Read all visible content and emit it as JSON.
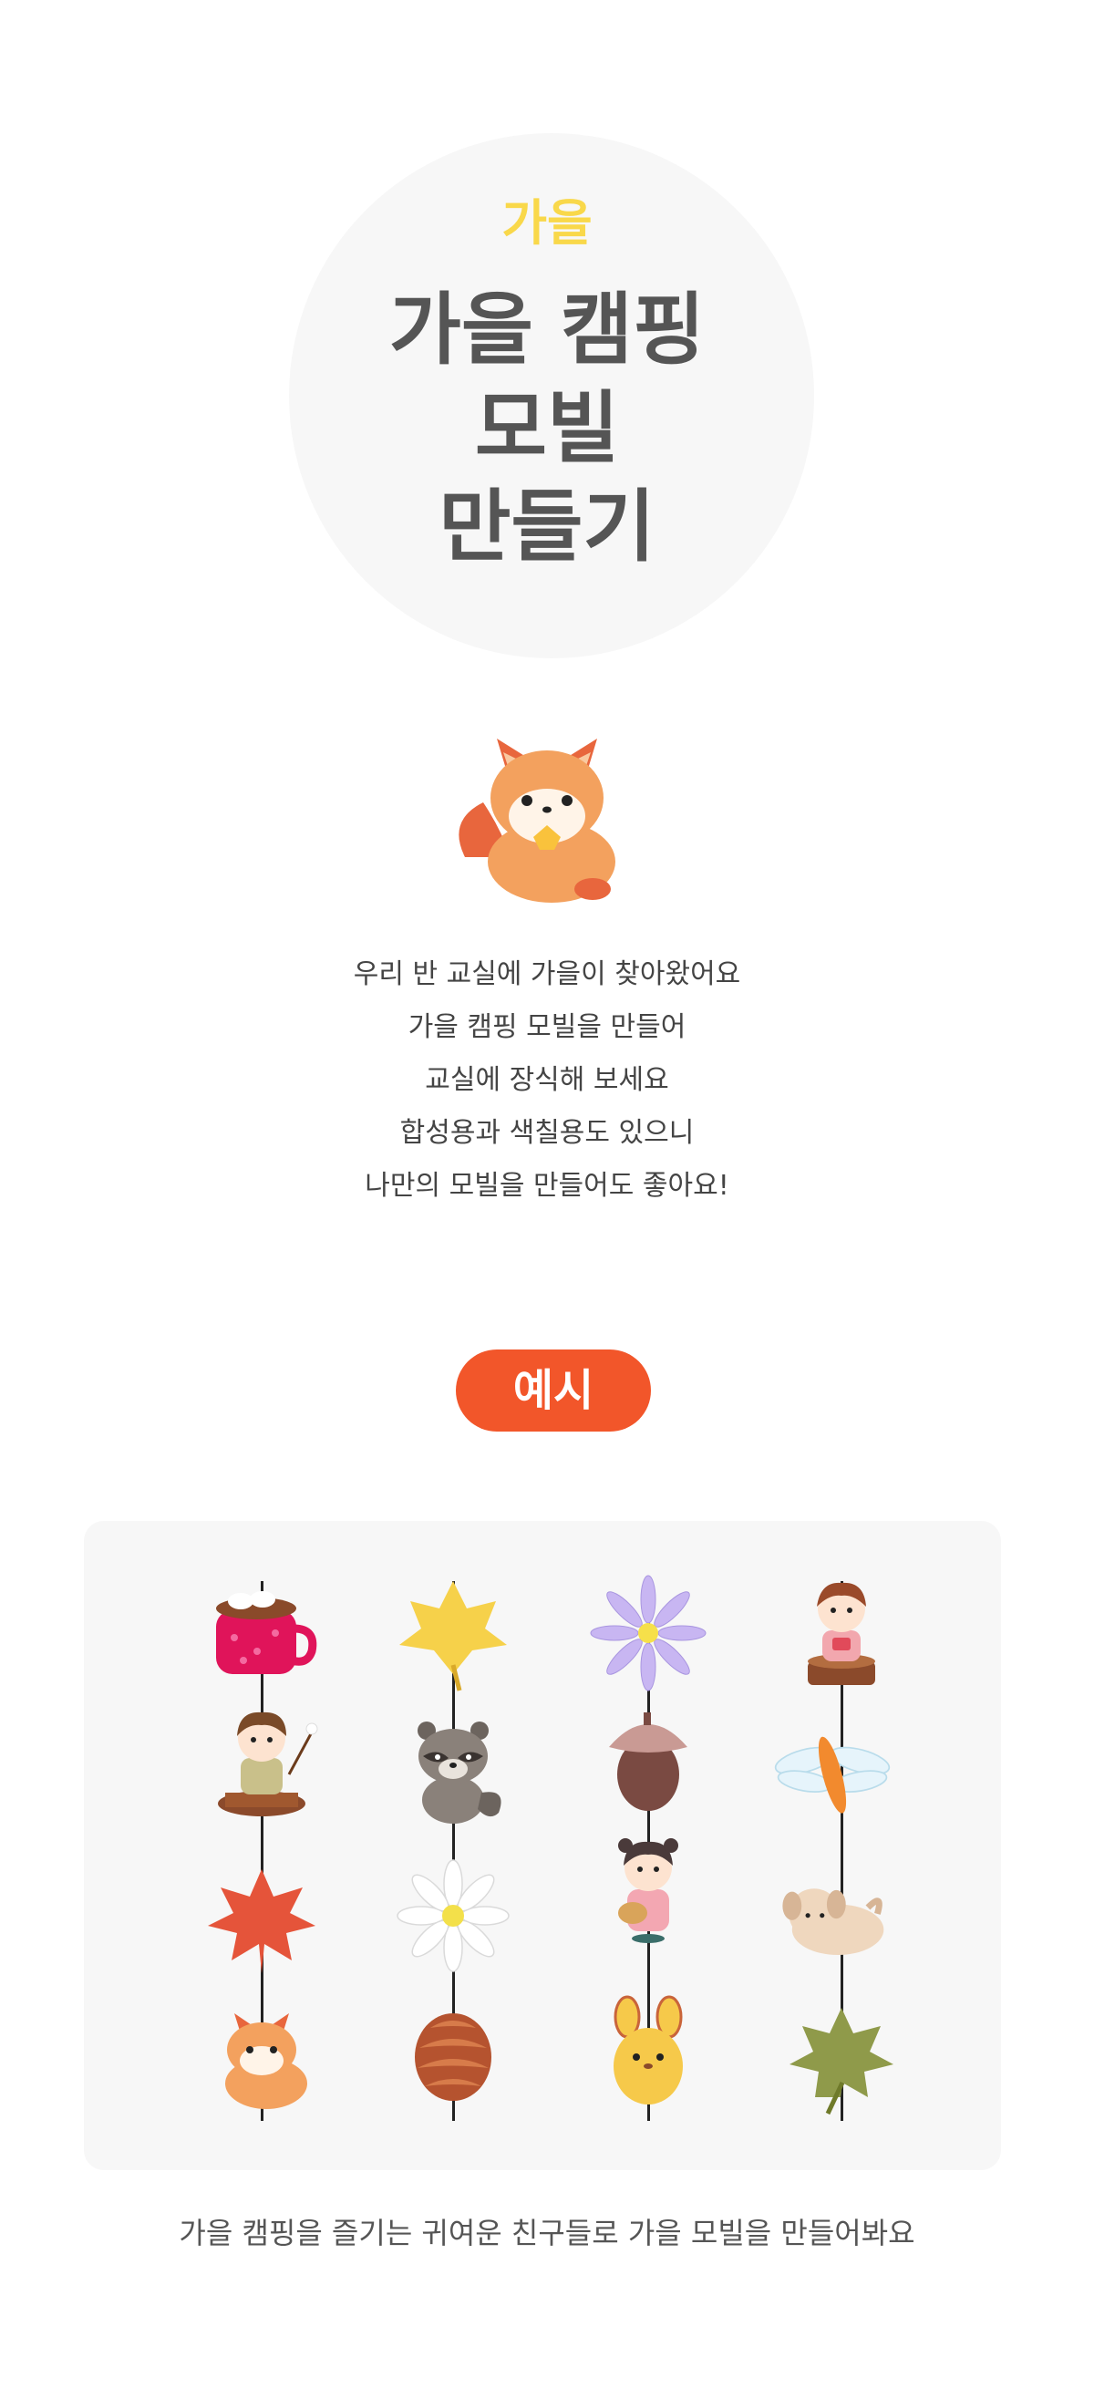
{
  "hero": {
    "season": "가을",
    "title_lines": [
      "가을 캠핑",
      "모빌",
      "만들기"
    ]
  },
  "intro": {
    "lines": [
      "우리 반 교실에 가을이 찾아왔어요",
      "가을 캠핑 모빌을 만들어",
      "교실에 장식해 보세요",
      "합성용과 색칠용도 있으니",
      "나만의 모빌을 만들어도 좋아요!"
    ]
  },
  "example": {
    "button_label": "예시",
    "columns": [
      [
        "cocoa-mug-icon",
        "girl-with-marshmallow-icon",
        "red-maple-leaf-icon",
        "fox-icon"
      ],
      [
        "yellow-leaf-icon",
        "raccoon-icon",
        "white-daisy-icon",
        "pinecone-icon"
      ],
      [
        "purple-aster-icon",
        "acorn-icon",
        "girl-with-basket-icon",
        "yellow-rabbit-icon"
      ],
      [
        "boy-on-stump-icon",
        "dragonfly-icon",
        "puppy-icon",
        "green-maple-leaf-icon"
      ]
    ],
    "caption": "가을 캠핑을 즐기는 귀여운 친구들로 가을 모빌을 만들어봐요"
  },
  "colors": {
    "accent_yellow": "#f9d84a",
    "accent_orange": "#f2562a",
    "title_gray": "#555555",
    "panel_bg": "#f7f7f7"
  }
}
